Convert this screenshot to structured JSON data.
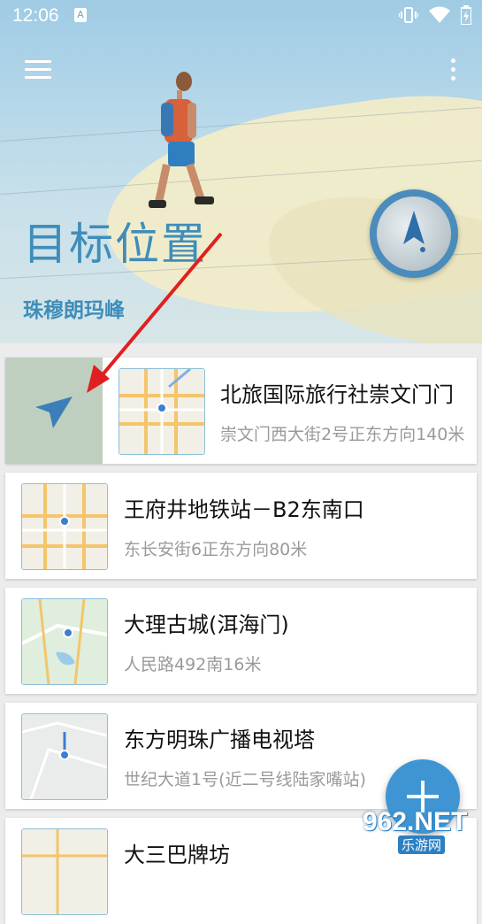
{
  "status_bar": {
    "time": "12:06",
    "notification_icon": "A",
    "icons": [
      "vibrate-icon",
      "wifi-icon",
      "battery-charging-icon"
    ]
  },
  "header": {
    "title": "目标位置",
    "subtitle": "珠穆朗玛峰",
    "menu_icon": "hamburger-menu-icon",
    "more_icon": "more-vertical-icon",
    "compass_icon": "compass-navigation-icon"
  },
  "locations": [
    {
      "name": "北旅国际旅行社崇文门门",
      "address": "崇文门西大街2号正东方向140米"
    },
    {
      "name": "王府井地铁站－B2东南口",
      "address": "东长安街6正东方向80米"
    },
    {
      "name": "大理古城(洱海门)",
      "address": "人民路492南16米"
    },
    {
      "name": "东方明珠广播电视塔",
      "address": "世纪大道1号(近二号线陆家嘴站)"
    },
    {
      "name": "大三巴牌坊",
      "address": ""
    }
  ],
  "fab": {
    "icon": "plus-icon"
  },
  "watermark": {
    "main": "962.NET",
    "sub": "乐游网"
  },
  "colors": {
    "accent": "#3f8dba",
    "fab": "#3f95d3",
    "nav_tile": "#bfcfbf",
    "arrow": "#e02020"
  }
}
